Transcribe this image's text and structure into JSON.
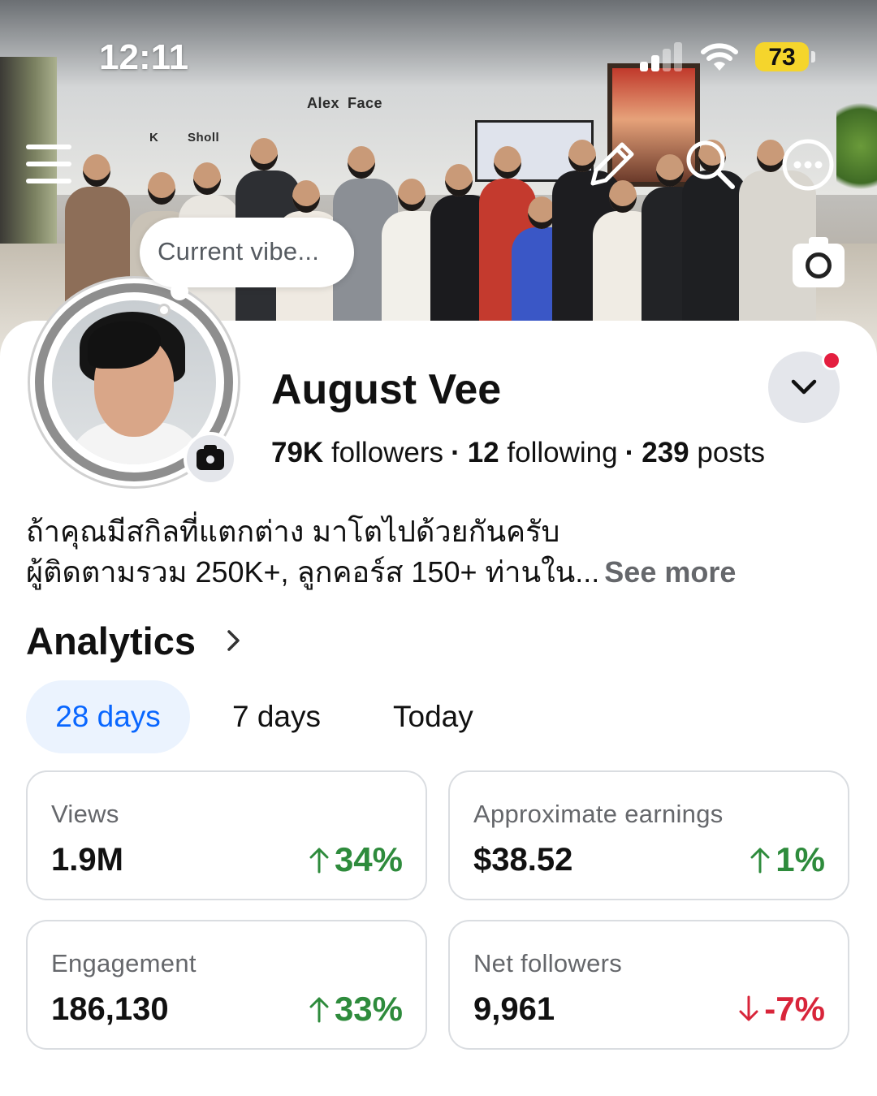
{
  "status_bar": {
    "time": "12:11",
    "battery": "73"
  },
  "cover": {
    "wall_texts": [
      "Alex",
      "Face",
      "K",
      "Sholl"
    ],
    "actions": [
      "menu-icon",
      "pencil-icon",
      "search-icon",
      "more-icon",
      "camera-icon"
    ]
  },
  "vibe": {
    "placeholder": "Current vibe..."
  },
  "profile": {
    "name": "August Vee",
    "followers_count": "79K",
    "followers_label": "followers",
    "following_count": "12",
    "following_label": "following",
    "posts_count": "239",
    "posts_label": "posts",
    "separator": "·"
  },
  "bio": {
    "line1": "ถ้าคุณมีสกิลที่แตกต่าง มาโตไปด้วยกันครับ",
    "line2": "ผู้ติดตามรวม 250K+, ลูกคอร์ส 150+ ท่านใน...",
    "see_more": "See more"
  },
  "analytics": {
    "title": "Analytics",
    "tabs": [
      {
        "label": "28 days",
        "active": true
      },
      {
        "label": "7 days",
        "active": false
      },
      {
        "label": "Today",
        "active": false
      }
    ],
    "metrics": [
      {
        "label": "Views",
        "value": "1.9M",
        "change": "34%",
        "direction": "up"
      },
      {
        "label": "Approximate earnings",
        "value": "$38.52",
        "change": "1%",
        "direction": "up"
      },
      {
        "label": "Engagement",
        "value": "186,130",
        "change": "33%",
        "direction": "up"
      },
      {
        "label": "Net followers",
        "value": "9,961",
        "change": "-7%",
        "direction": "down"
      }
    ]
  },
  "colors": {
    "accent_blue": "#0866ff",
    "tab_active_bg": "#ebf3fe",
    "positive_green": "#2e8b3c",
    "negative_red": "#d8253a",
    "notification_red": "#e41e3f",
    "battery_yellow": "#f5d52c"
  }
}
